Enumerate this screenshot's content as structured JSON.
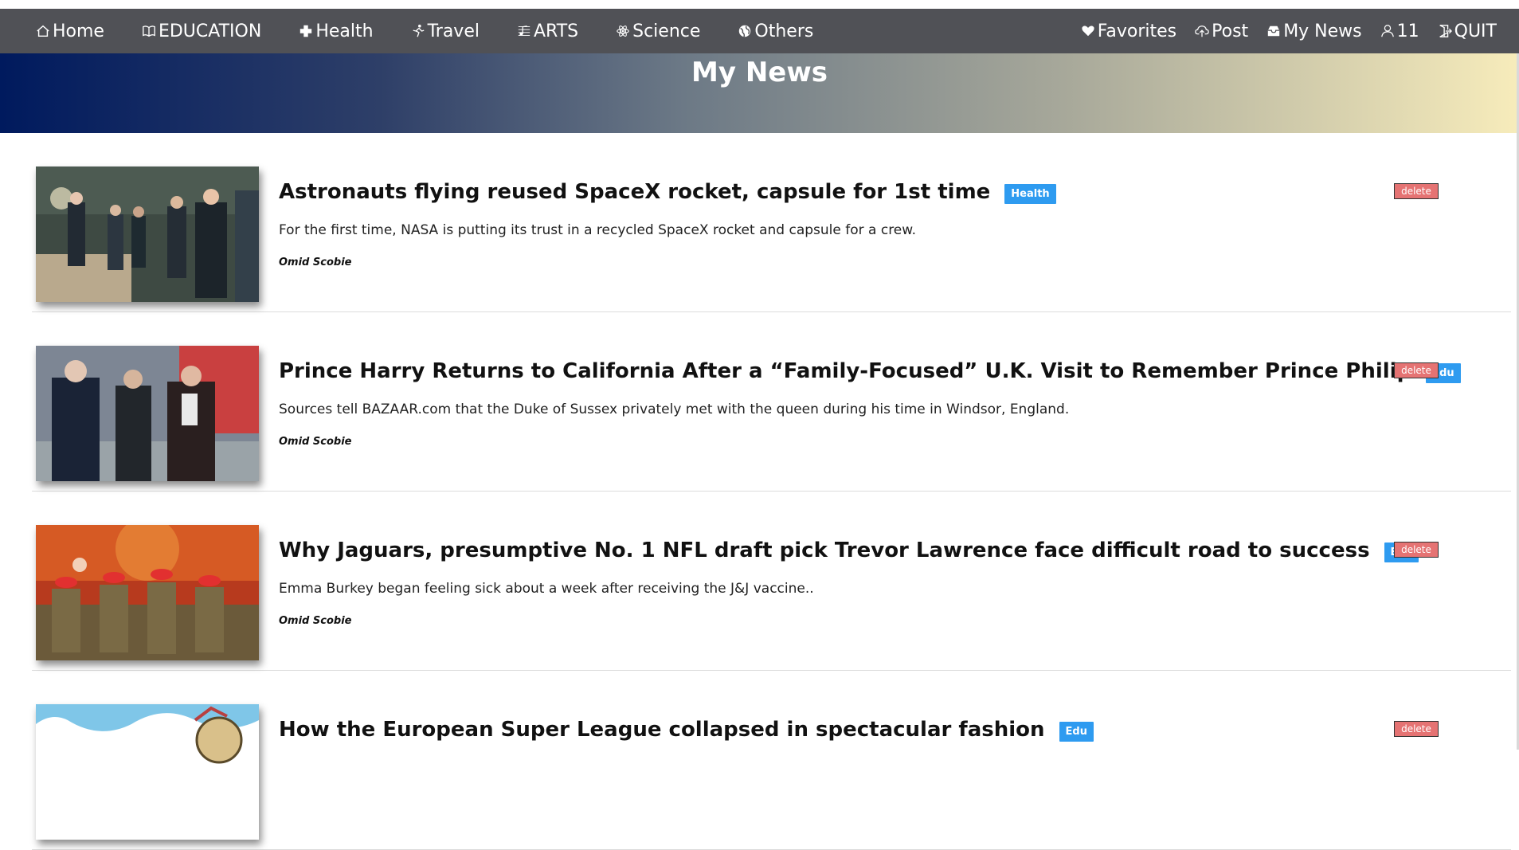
{
  "nav": {
    "left": [
      {
        "label": "Home",
        "icon": "home-icon"
      },
      {
        "label": " EDUCATION",
        "icon": "book-icon"
      },
      {
        "label": "Health",
        "icon": "plus-icon"
      },
      {
        "label": "Travel",
        "icon": "runner-icon"
      },
      {
        "label": "ARTS",
        "icon": "music-icon"
      },
      {
        "label": "Science",
        "icon": "atom-icon"
      },
      {
        "label": "Others",
        "icon": "globe-icon"
      }
    ],
    "right": [
      {
        "label": "Favorites",
        "icon": "heart-icon"
      },
      {
        "label": "Post",
        "icon": "upload-cloud-icon"
      },
      {
        "label": "My News",
        "icon": "inbox-icon"
      },
      {
        "label": "11",
        "icon": "user-icon"
      },
      {
        "label": "QUIT",
        "icon": "exit-icon"
      }
    ]
  },
  "banner": {
    "title": "My News"
  },
  "news": [
    {
      "title": "Astronauts flying reused SpaceX rocket, capsule for 1st time",
      "tag": "Health",
      "desc": "For the first time, NASA is putting its trust in a recycled SpaceX rocket and capsule for a crew.",
      "author": "Omid Scobie",
      "delete_label": "delete",
      "thumb": "photo-meeting"
    },
    {
      "title": "Prince Harry Returns to California After a “Family-Focused” U.K. Visit to Remember Prince Philip",
      "tag": "Edu",
      "desc": "Sources tell BAZAAR.com that the Duke of Sussex privately met with the queen during his time in Windsor, England.",
      "author": "Omid Scobie",
      "delete_label": "delete",
      "thumb": "photo-managers"
    },
    {
      "title": "Why Jaguars, presumptive No. 1 NFL draft pick Trevor Lawrence face difficult road to success",
      "tag": "Edu",
      "desc": "Emma Burkey began feeling sick about a week after receiving the J&J vaccine..",
      "author": "Omid Scobie",
      "delete_label": "delete",
      "thumb": "photo-dancers"
    },
    {
      "title": "How the European Super League collapsed in spectacular fashion",
      "tag": "Edu",
      "desc": "",
      "author": "",
      "delete_label": "delete",
      "thumb": "illustration-cartoon"
    }
  ]
}
